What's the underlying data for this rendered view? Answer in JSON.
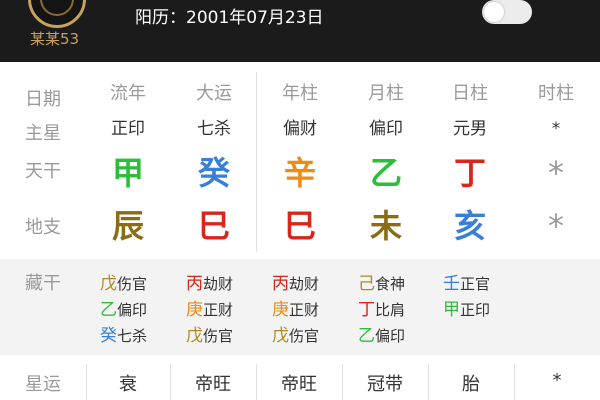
{
  "header": {
    "username": "某某53",
    "solar_date": "阳历：2001年07月23日",
    "toggle_on": false
  },
  "columns": [
    "流年",
    "大运",
    "年柱",
    "月柱",
    "日柱",
    "时柱"
  ],
  "row_labels": {
    "date": "日期",
    "main_star": "主星",
    "heaven_stem": "天干",
    "earth_branch": "地支",
    "hidden_stem": "藏干",
    "star_luck": "星运"
  },
  "main_star": [
    "正印",
    "七杀",
    "偏财",
    "偏印",
    "元男",
    "*"
  ],
  "heaven_stem": [
    {
      "char": "甲",
      "color": "#2dbd3a"
    },
    {
      "char": "癸",
      "color": "#3a7fd6"
    },
    {
      "char": "辛",
      "color": "#ef8a12"
    },
    {
      "char": "乙",
      "color": "#2dbd3a"
    },
    {
      "char": "丁",
      "color": "#d9261c"
    },
    {
      "char": "*",
      "color": "#9a9a9a"
    }
  ],
  "earth_branch": [
    {
      "char": "辰",
      "color": "#8a6b16"
    },
    {
      "char": "巳",
      "color": "#d9261c"
    },
    {
      "char": "巳",
      "color": "#d9261c"
    },
    {
      "char": "未",
      "color": "#8a6b16"
    },
    {
      "char": "亥",
      "color": "#3a7fd6"
    },
    {
      "char": "*",
      "color": "#9a9a9a"
    }
  ],
  "hidden_stems": [
    [
      {
        "stem": "戊",
        "god": "伤官",
        "color": "#b08a1f"
      },
      {
        "stem": "乙",
        "god": "偏印",
        "color": "#2dbd3a"
      },
      {
        "stem": "癸",
        "god": "七杀",
        "color": "#3a7fd6"
      }
    ],
    [
      {
        "stem": "丙",
        "god": "劫财",
        "color": "#d9261c"
      },
      {
        "stem": "庚",
        "god": "正财",
        "color": "#ef8a12"
      },
      {
        "stem": "戊",
        "god": "伤官",
        "color": "#b08a1f"
      }
    ],
    [
      {
        "stem": "丙",
        "god": "劫财",
        "color": "#d9261c"
      },
      {
        "stem": "庚",
        "god": "正财",
        "color": "#ef8a12"
      },
      {
        "stem": "戊",
        "god": "伤官",
        "color": "#b08a1f"
      }
    ],
    [
      {
        "stem": "己",
        "god": "食神",
        "color": "#b08a1f"
      },
      {
        "stem": "丁",
        "god": "比肩",
        "color": "#d9261c"
      },
      {
        "stem": "乙",
        "god": "偏印",
        "color": "#2dbd3a"
      }
    ],
    [
      {
        "stem": "壬",
        "god": "正官",
        "color": "#3a7fd6"
      },
      {
        "stem": "甲",
        "god": "正印",
        "color": "#2dbd3a"
      }
    ]
  ],
  "star_luck": [
    "衰",
    "帝旺",
    "帝旺",
    "冠带",
    "胎",
    "*"
  ]
}
